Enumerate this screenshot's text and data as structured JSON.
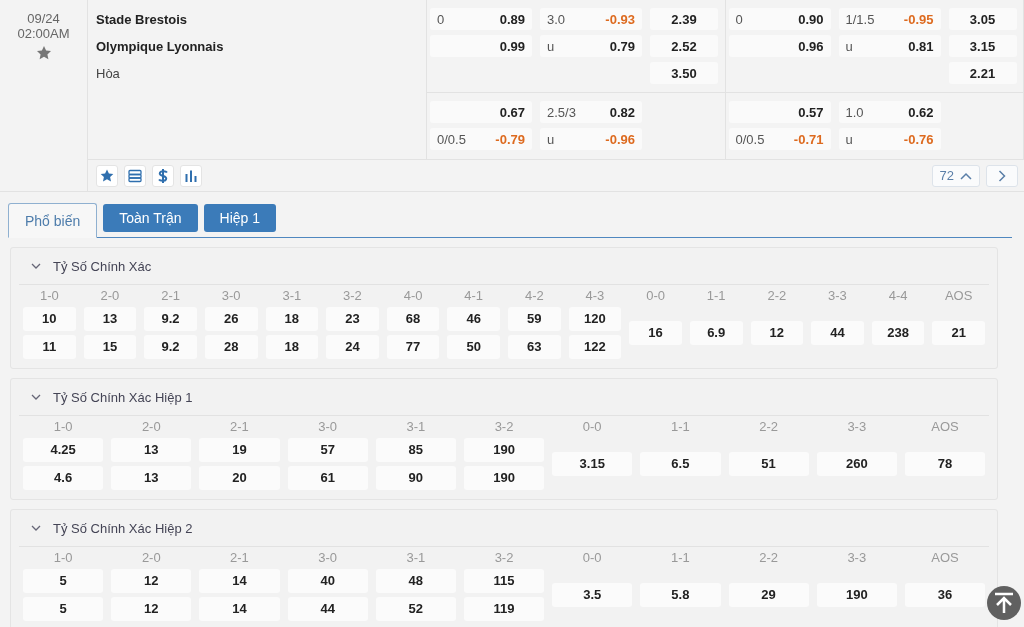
{
  "match": {
    "date": "09/24",
    "time": "02:00AM",
    "teams": [
      "Stade Brestois",
      "Olympique Lyonnais"
    ],
    "draw_label": "Hòa"
  },
  "markets": [
    {
      "blocks": [
        {
          "rows": [
            {
              "handicap": {
                "line": "0",
                "odds": "0.89",
                "negative": false
              },
              "total": {
                "line": "3.0",
                "odds": "-0.93",
                "negative": true
              },
              "result": "2.39"
            },
            {
              "handicap": {
                "odds": "0.99",
                "negative": false
              },
              "total": {
                "line": "u",
                "odds": "0.79",
                "negative": false
              },
              "result": "2.52"
            },
            {
              "result": "3.50"
            }
          ]
        },
        {
          "rows": [
            {
              "handicap": {
                "odds": "0.67",
                "negative": false
              },
              "total": {
                "line": "2.5/3",
                "odds": "0.82",
                "negative": false
              }
            },
            {
              "handicap": {
                "line": "0/0.5",
                "odds": "-0.79",
                "negative": true
              },
              "total": {
                "line": "u",
                "odds": "-0.96",
                "negative": true
              }
            }
          ]
        }
      ]
    },
    {
      "blocks": [
        {
          "rows": [
            {
              "handicap": {
                "line": "0",
                "odds": "0.90",
                "negative": false
              },
              "total": {
                "line": "1/1.5",
                "odds": "-0.95",
                "negative": true
              },
              "result": "3.05"
            },
            {
              "handicap": {
                "odds": "0.96",
                "negative": false
              },
              "total": {
                "line": "u",
                "odds": "0.81",
                "negative": false
              },
              "result": "3.15"
            },
            {
              "result": "2.21"
            }
          ]
        },
        {
          "rows": [
            {
              "handicap": {
                "odds": "0.57",
                "negative": false
              },
              "total": {
                "line": "1.0",
                "odds": "0.62",
                "negative": false
              }
            },
            {
              "handicap": {
                "line": "0/0.5",
                "odds": "-0.71",
                "negative": true
              },
              "total": {
                "line": "u",
                "odds": "-0.76",
                "negative": true
              }
            }
          ]
        }
      ]
    }
  ],
  "toolbar": {
    "buttons": [
      {
        "kind": "star"
      },
      {
        "kind": "layers"
      },
      {
        "kind": "dollar"
      },
      {
        "kind": "chart"
      }
    ],
    "market_count": "72"
  },
  "tabs": [
    {
      "label": "Phổ biến",
      "selected": true
    },
    {
      "label": "Toàn Trận",
      "selected": false
    },
    {
      "label": "Hiệp 1",
      "selected": false
    }
  ],
  "sections": [
    {
      "title": "Tỷ Số Chính Xác",
      "expanded": true,
      "columns": [
        {
          "label": "1-0",
          "values": [
            "10",
            "11"
          ]
        },
        {
          "label": "2-0",
          "values": [
            "13",
            "15"
          ]
        },
        {
          "label": "2-1",
          "values": [
            "9.2",
            "9.2"
          ]
        },
        {
          "label": "3-0",
          "values": [
            "26",
            "28"
          ]
        },
        {
          "label": "3-1",
          "values": [
            "18",
            "18"
          ]
        },
        {
          "label": "3-2",
          "values": [
            "23",
            "24"
          ]
        },
        {
          "label": "4-0",
          "values": [
            "68",
            "77"
          ]
        },
        {
          "label": "4-1",
          "values": [
            "46",
            "50"
          ]
        },
        {
          "label": "4-2",
          "values": [
            "59",
            "63"
          ]
        },
        {
          "label": "4-3",
          "values": [
            "120",
            "122"
          ]
        },
        {
          "label": "0-0",
          "values": [
            "16"
          ]
        },
        {
          "label": "1-1",
          "values": [
            "6.9"
          ]
        },
        {
          "label": "2-2",
          "values": [
            "12"
          ]
        },
        {
          "label": "3-3",
          "values": [
            "44"
          ]
        },
        {
          "label": "4-4",
          "values": [
            "238"
          ]
        },
        {
          "label": "AOS",
          "values": [
            "21"
          ]
        }
      ]
    },
    {
      "title": "Tỷ Số Chính Xác Hiệp 1",
      "expanded": true,
      "columns": [
        {
          "label": "1-0",
          "values": [
            "4.25",
            "4.6"
          ]
        },
        {
          "label": "2-0",
          "values": [
            "13",
            "13"
          ]
        },
        {
          "label": "2-1",
          "values": [
            "19",
            "20"
          ]
        },
        {
          "label": "3-0",
          "values": [
            "57",
            "61"
          ]
        },
        {
          "label": "3-1",
          "values": [
            "85",
            "90"
          ]
        },
        {
          "label": "3-2",
          "values": [
            "190",
            "190"
          ]
        },
        {
          "label": "0-0",
          "values": [
            "3.15"
          ]
        },
        {
          "label": "1-1",
          "values": [
            "6.5"
          ]
        },
        {
          "label": "2-2",
          "values": [
            "51"
          ]
        },
        {
          "label": "3-3",
          "values": [
            "260"
          ]
        },
        {
          "label": "AOS",
          "values": [
            "78"
          ]
        }
      ]
    },
    {
      "title": "Tỷ Số Chính Xác Hiệp 2",
      "expanded": true,
      "columns": [
        {
          "label": "1-0",
          "values": [
            "5",
            "5"
          ]
        },
        {
          "label": "2-0",
          "values": [
            "12",
            "12"
          ]
        },
        {
          "label": "2-1",
          "values": [
            "14",
            "14"
          ]
        },
        {
          "label": "3-0",
          "values": [
            "40",
            "44"
          ]
        },
        {
          "label": "3-1",
          "values": [
            "48",
            "52"
          ]
        },
        {
          "label": "3-2",
          "values": [
            "115",
            "119"
          ]
        },
        {
          "label": "0-0",
          "values": [
            "3.5"
          ]
        },
        {
          "label": "1-1",
          "values": [
            "5.8"
          ]
        },
        {
          "label": "2-2",
          "values": [
            "29"
          ]
        },
        {
          "label": "3-3",
          "values": [
            "190"
          ]
        },
        {
          "label": "AOS",
          "values": [
            "36"
          ]
        }
      ]
    }
  ]
}
